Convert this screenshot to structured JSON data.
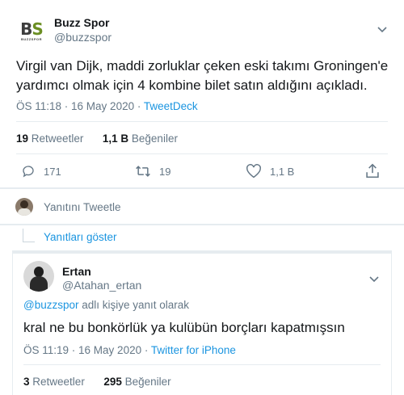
{
  "main_tweet": {
    "avatar_text": "BS",
    "avatar_subtext": "BUZZSPOR",
    "name": "Buzz Spor",
    "handle": "@buzzspor",
    "text_line1": "Virgil van Dijk, maddi zorluklar çeken eski takımı Groningen'e",
    "text_line2": "yardımcı olmak için 4 kombine bilet satın aldığını açıkladı.",
    "time": "ÖS 11:18 · 16 May 2020 · ",
    "source": "TweetDeck",
    "retweet_count": "19",
    "retweet_label": "Retweetler",
    "like_count": "1,1 B",
    "like_label": "Beğeniler",
    "actions": {
      "reply_count": "171",
      "retweet_count": "19",
      "like_count": "1,1 B"
    }
  },
  "reply_box": {
    "placeholder": "Yanıtını Tweetle"
  },
  "show_replies": "Yanıtları göster",
  "reply_tweet": {
    "name": "Ertan",
    "handle": "@Atahan_ertan",
    "reply_to_mention": "@buzzspor",
    "reply_to_suffix": " adlı kişiye yanıt olarak",
    "text": "kral ne bu bonkörlük ya kulübün borçları kapatmışsın",
    "time": "ÖS 11:19 · 16 May 2020 · ",
    "source": "Twitter for iPhone",
    "retweet_count": "3",
    "retweet_label": "Retweetler",
    "like_count": "295",
    "like_label": "Beğeniler"
  },
  "colors": {
    "accent": "#1b95e0",
    "text": "#14171a",
    "muted": "#657786",
    "border": "#e6ecf0"
  }
}
